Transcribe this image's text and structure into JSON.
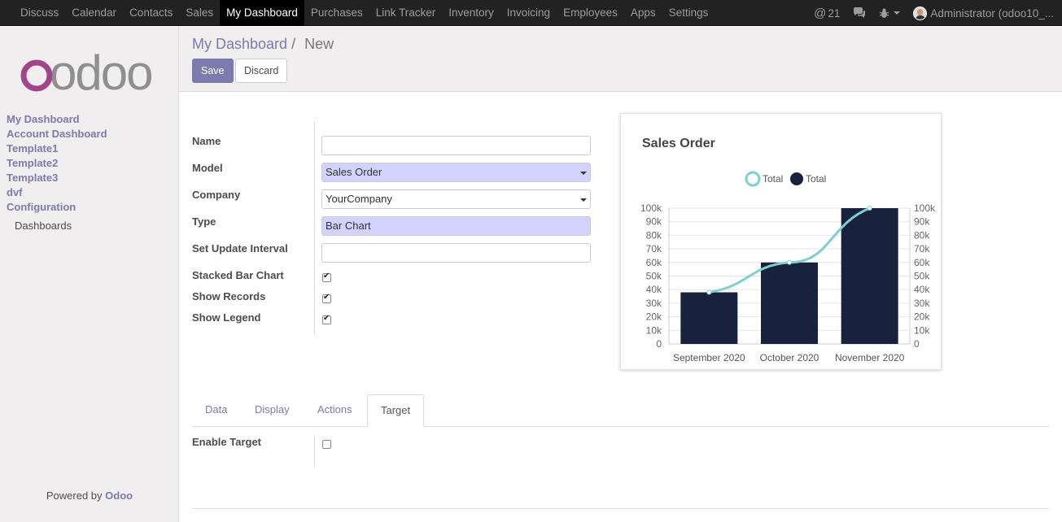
{
  "topbar": {
    "menu": [
      "Discuss",
      "Calendar",
      "Contacts",
      "Sales",
      "My Dashboard",
      "Purchases",
      "Link Tracker",
      "Inventory",
      "Invoicing",
      "Employees",
      "Apps",
      "Settings"
    ],
    "active_menu": "My Dashboard",
    "mentions_count": "21",
    "user_label": "Administrator (odoo10_..."
  },
  "sidebar": {
    "logo_text": "odoo",
    "links": [
      "My Dashboard",
      "Account Dashboard",
      "Template1",
      "Template2",
      "Template3",
      "dvf",
      "Configuration"
    ],
    "sub_item": "Dashboards",
    "powered_prefix": "Powered by",
    "powered_brand": "Odoo"
  },
  "control_panel": {
    "breadcrumb_parent": "My Dashboard",
    "breadcrumb_sep": "/",
    "breadcrumb_current": "New",
    "save_label": "Save",
    "discard_label": "Discard"
  },
  "form": {
    "name_label": "Name",
    "name_value": "",
    "model_label": "Model",
    "model_value": "Sales Order",
    "company_label": "Company",
    "company_value": "YourCompany",
    "type_label": "Type",
    "type_value": "Bar Chart",
    "interval_label": "Set Update Interval",
    "interval_value": "",
    "stacked_label": "Stacked Bar Chart",
    "stacked_checked": true,
    "records_label": "Show Records",
    "records_checked": true,
    "legend_label": "Show Legend",
    "legend_checked": true,
    "enable_target_label": "Enable Target",
    "enable_target_checked": false
  },
  "tabs": [
    "Data",
    "Display",
    "Actions",
    "Target"
  ],
  "active_tab": "Target",
  "colors": {
    "accent": "#7c7bad",
    "bar": "#18223c",
    "line": "#7ecfd0"
  },
  "chart_data": {
    "type": "bar",
    "title": "Sales Order",
    "categories": [
      "September 2020",
      "October 2020",
      "November 2020"
    ],
    "series": [
      {
        "name": "Total",
        "kind": "line",
        "values": [
          38000,
          60000,
          100000
        ]
      },
      {
        "name": "Total",
        "kind": "bar",
        "values": [
          38000,
          60000,
          100000
        ]
      }
    ],
    "ylim": [
      0,
      100000
    ],
    "y_ticks": [
      "0",
      "10k",
      "20k",
      "30k",
      "40k",
      "50k",
      "60k",
      "70k",
      "80k",
      "90k",
      "100k"
    ],
    "grid": true,
    "legend": "top"
  }
}
